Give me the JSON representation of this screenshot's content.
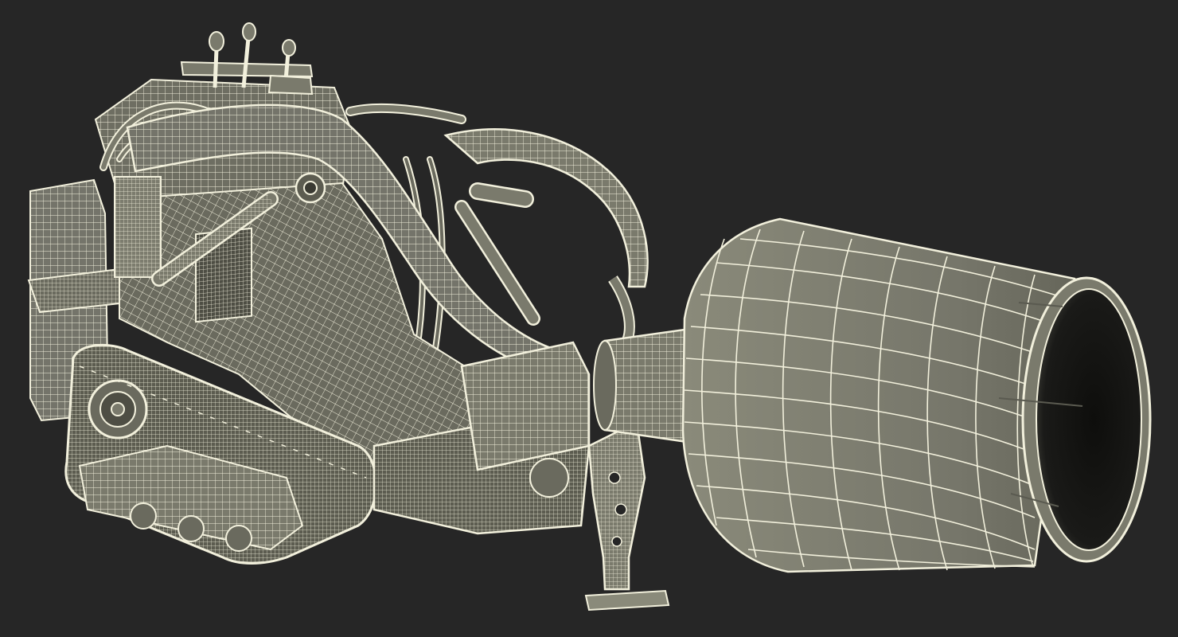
{
  "scene": {
    "subject": "mini-track-loader-with-concrete-mixer-attachment",
    "render_style": "wireframe-over-shaded",
    "colors": {
      "background": "#262626",
      "surface": "#7a7a6c",
      "surface_dark": "#5c5c50",
      "surface_light": "#8c8c7c",
      "wire": "#f2f0dc",
      "drum_inside": "#161614"
    }
  }
}
